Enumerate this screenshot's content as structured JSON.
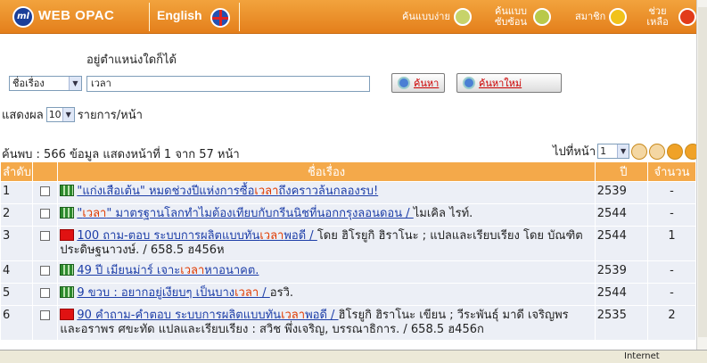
{
  "header": {
    "brand": "WEB OPAC",
    "logo_text": "ml",
    "language": "English",
    "nav": [
      {
        "label": "ค้นแบบง่าย",
        "icon": "simple-search-icon"
      },
      {
        "label": "ค้นแบบซับซ้อน",
        "icon": "advanced-search-icon"
      },
      {
        "label": "สมาชิก",
        "icon": "member-icon"
      },
      {
        "label": "ช่วยเหลือ",
        "icon": "help-icon"
      }
    ],
    "colors": {
      "bar": "#e8861f",
      "text": "#ffffff"
    }
  },
  "search": {
    "hint": "อยู่ตำแหน่งใดก็ได้",
    "field": "ชื่อเรื่อง",
    "query": "เวลา",
    "search_button": "ค้นหา",
    "new_search_button": "ค้นหาใหม่",
    "show_label": "แสดงผล",
    "per_page": "10",
    "per_page_unit": "รายการ/หน้า"
  },
  "summary": {
    "found_text": "ค้นพบ : 566 ข้อมูล แสดงหน้าที่ 1 จาก 57 หน้า",
    "goto_label": "ไปที่หน้า",
    "goto_page": "1"
  },
  "table": {
    "headers": [
      "ลำดับ",
      "ชื่อเรื่อง",
      "ปี",
      "จำนวน"
    ],
    "rows": [
      {
        "no": "1",
        "icon": "book-icon-green",
        "pre": "\"แก่งเสือเต้น\" หมดช่วงปีแห่งการซื้อ",
        "hl": "เวลา",
        "post": "ถึงคราวล้นกลองรบ! ",
        "rest": "",
        "year": "2539",
        "count": "-"
      },
      {
        "no": "2",
        "icon": "book-icon-green",
        "pre": "\"",
        "hl": "เวลา",
        "post": "\" มาตรฐานโลกทำไมต้องเทียบกับกรีนนิชที่นอกกรุงลอนดอน / ",
        "rest": "ไมเคิล ไรท์.",
        "year": "2544",
        "count": "-"
      },
      {
        "no": "3",
        "icon": "book-icon-red",
        "pre": "100 ถาม-ตอบ ระบบการผลิตแบบทัน",
        "hl": "เวลา",
        "post": "พอดี / ",
        "rest": "โดย ฮิโรยูกิ ฮิราโนะ ; แปลและเรียบเรียง โดย บัณฑิต ประดิษฐนาวงษ์. / 658.5 ฮ456ห",
        "year": "2544",
        "count": "1"
      },
      {
        "no": "4",
        "icon": "book-icon-green",
        "pre": "49 ปี เมียนม่าร์ เจาะ",
        "hl": "เวลา",
        "post": "หาอนาคต.",
        "rest": "",
        "year": "2539",
        "count": "-"
      },
      {
        "no": "5",
        "icon": "book-icon-green",
        "pre": "9 ขวบ : อยากอยู่เงียบๆ เป็นบาง",
        "hl": "เวลา",
        "post": " / ",
        "rest": "อรวิ.",
        "year": "2544",
        "count": "-"
      },
      {
        "no": "6",
        "icon": "book-icon-red",
        "pre": "90 คำถาม-คำตอบ ระบบการผลิตแบบทัน",
        "hl": "เวลา",
        "post": "พอดี / ",
        "rest": "ฮิโรยูกิ ฮิราโนะ เขียน ; วีระพันธุ์ มาดี เจริญพร และอราพร ศขะทัด แปลและเรียบเรียง : สวิช พึ่งเจริญ, บรรณาธิการ. / 658.5 ฮ456ก",
        "year": "2535",
        "count": "2"
      }
    ]
  },
  "status": {
    "zone": "Internet"
  }
}
